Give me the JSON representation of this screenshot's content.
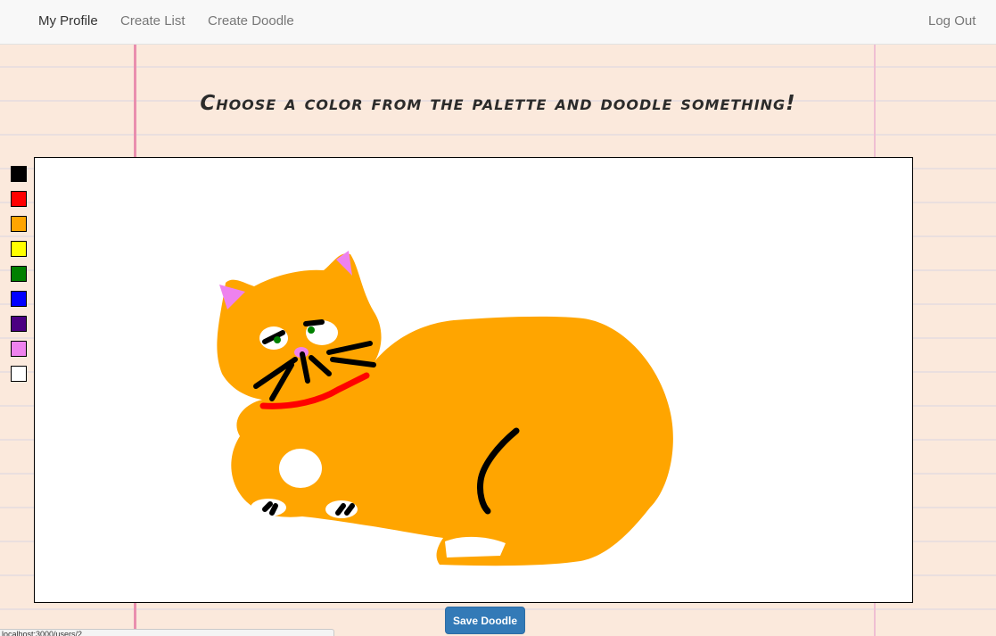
{
  "nav": {
    "my_profile": "My Profile",
    "create_list": "Create List",
    "create_doodle": "Create Doodle",
    "log_out": "Log Out"
  },
  "heading": "Choose a color from the palette and doodle something!",
  "palette": [
    {
      "name": "black",
      "color": "#000000"
    },
    {
      "name": "red",
      "color": "#ff0000"
    },
    {
      "name": "orange",
      "color": "#ffa500"
    },
    {
      "name": "yellow",
      "color": "#ffff00"
    },
    {
      "name": "green",
      "color": "#008000"
    },
    {
      "name": "blue",
      "color": "#0000ff"
    },
    {
      "name": "indigo",
      "color": "#4b0082"
    },
    {
      "name": "violet",
      "color": "#ee82ee"
    },
    {
      "name": "white",
      "color": "#ffffff"
    }
  ],
  "save_button": "Save Doodle",
  "status_url": "localhost:3000/users/2"
}
